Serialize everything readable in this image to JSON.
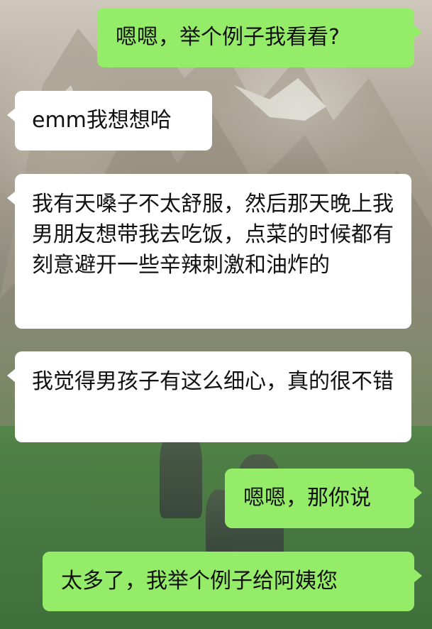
{
  "background": {
    "image": "mountain-landscape-wallpaper"
  },
  "colors": {
    "sent_bubble": "#95ec69",
    "received_bubble": "#ffffff",
    "text": "#111111"
  },
  "messages": [
    {
      "side": "right",
      "text": "嗯嗯，举个例子我看看?"
    },
    {
      "side": "left",
      "text": "emm我想想哈"
    },
    {
      "side": "left",
      "text": "我有天嗓子不太舒服，然后那天晚上我男朋友想带我去吃饭，点菜的时候都有刻意避开一些辛辣刺激和油炸的"
    },
    {
      "side": "left",
      "text": "我觉得男孩子有这么细心，真的很不错"
    },
    {
      "side": "right",
      "text": "嗯嗯，那你说"
    },
    {
      "side": "right",
      "text": "太多了，我举个例子给阿姨您"
    }
  ]
}
